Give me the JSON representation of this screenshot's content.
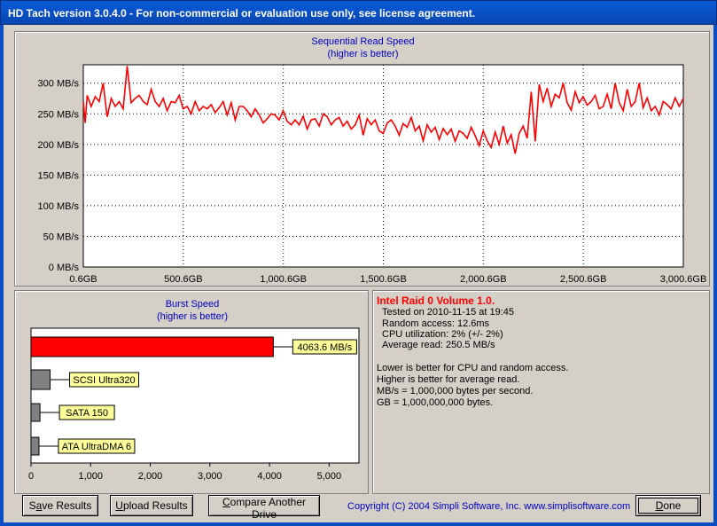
{
  "window": {
    "title": "HD Tach version 3.0.4.0  - For non-commercial or evaluation use only, see license agreement."
  },
  "chart_data": [
    {
      "type": "line",
      "title": "Sequential Read Speed",
      "subtitle": "(higher is better)",
      "ylim": [
        0,
        330
      ],
      "xlim": [
        0.6,
        3000.6
      ],
      "y_ticks": [
        "0 MB/s",
        "50 MB/s",
        "100 MB/s",
        "150 MB/s",
        "200 MB/s",
        "250 MB/s",
        "300 MB/s"
      ],
      "y_tick_values": [
        0,
        50,
        100,
        150,
        200,
        250,
        300
      ],
      "x_ticks": [
        "0.6GB",
        "500.6GB",
        "1,000.6GB",
        "1,500.6GB",
        "2,000.6GB",
        "2,500.6GB",
        "3,000.6GB"
      ],
      "x_tick_values": [
        0.6,
        500.6,
        1000.6,
        1500.6,
        2000.6,
        2500.6,
        3000.6
      ],
      "grid": true,
      "line_color": "#ff0000",
      "x": [
        0.6,
        10,
        20,
        40,
        60,
        80,
        100,
        120,
        140,
        160,
        180,
        200,
        220,
        240,
        260,
        280,
        300,
        320,
        340,
        360,
        380,
        400,
        420,
        440,
        460,
        480,
        500,
        520,
        540,
        560,
        580,
        600,
        620,
        640,
        660,
        680,
        700,
        720,
        740,
        760,
        780,
        800,
        820,
        840,
        860,
        880,
        900,
        920,
        940,
        960,
        980,
        1000,
        1020,
        1040,
        1060,
        1080,
        1100,
        1120,
        1140,
        1160,
        1180,
        1200,
        1220,
        1240,
        1260,
        1280,
        1300,
        1320,
        1340,
        1360,
        1380,
        1400,
        1420,
        1440,
        1460,
        1480,
        1500,
        1520,
        1540,
        1560,
        1580,
        1600,
        1620,
        1640,
        1660,
        1680,
        1700,
        1720,
        1740,
        1760,
        1780,
        1800,
        1820,
        1840,
        1860,
        1880,
        1900,
        1920,
        1940,
        1960,
        1980,
        2000,
        2020,
        2040,
        2060,
        2080,
        2100,
        2120,
        2140,
        2160,
        2180,
        2200,
        2220,
        2240,
        2260,
        2280,
        2300,
        2320,
        2340,
        2360,
        2380,
        2400,
        2420,
        2440,
        2460,
        2480,
        2500,
        2520,
        2540,
        2560,
        2580,
        2600,
        2620,
        2640,
        2660,
        2680,
        2700,
        2720,
        2740,
        2760,
        2780,
        2800,
        2820,
        2840,
        2860,
        2880,
        2900,
        2920,
        2940,
        2960,
        2980,
        3000.6
      ],
      "y": [
        270,
        235,
        280,
        262,
        278,
        270,
        300,
        245,
        275,
        262,
        270,
        258,
        328,
        268,
        275,
        280,
        270,
        265,
        290,
        270,
        262,
        275,
        255,
        270,
        268,
        280,
        258,
        262,
        250,
        270,
        255,
        262,
        258,
        265,
        252,
        260,
        270,
        248,
        268,
        240,
        262,
        262,
        255,
        245,
        258,
        248,
        235,
        242,
        250,
        248,
        240,
        255,
        238,
        232,
        240,
        232,
        246,
        225,
        240,
        242,
        230,
        250,
        245,
        232,
        240,
        244,
        230,
        238,
        225,
        232,
        248,
        215,
        242,
        232,
        240,
        222,
        218,
        235,
        240,
        230,
        215,
        234,
        228,
        244,
        222,
        230,
        206,
        232,
        220,
        228,
        208,
        226,
        216,
        225,
        205,
        222,
        218,
        210,
        228,
        214,
        198,
        222,
        206,
        195,
        220,
        200,
        230,
        202,
        216,
        185,
        218,
        230,
        210,
        286,
        205,
        298,
        270,
        292,
        262,
        282,
        276,
        300,
        268,
        256,
        286,
        268,
        278,
        264,
        270,
        280,
        258,
        262,
        282,
        258,
        300,
        268,
        255,
        290,
        262,
        270,
        300,
        260,
        276,
        255,
        262,
        248,
        270,
        265,
        258,
        276,
        262,
        275,
        268,
        275,
        265,
        252
      ]
    },
    {
      "type": "bar",
      "orientation": "horizontal",
      "title": "Burst Speed",
      "subtitle": "(higher is better)",
      "xlim": [
        0,
        5500
      ],
      "x_ticks": [
        "0",
        "1,000",
        "2,000",
        "3,000",
        "4,000",
        "5,000"
      ],
      "x_tick_values": [
        0,
        1000,
        2000,
        3000,
        4000,
        5000
      ],
      "categories": [
        "4063.6 MB/s",
        "SCSI Ultra320",
        "SATA 150",
        "ATA UltraDMA 6"
      ],
      "values": [
        4063.6,
        320,
        150,
        133
      ],
      "colors": [
        "#ff0000",
        "#808080",
        "#808080",
        "#808080"
      ],
      "label_bg": "#ffff99"
    }
  ],
  "info": {
    "heading": "Intel Raid 0 Volume 1.0.",
    "tested": "Tested on 2010-11-15 at 19:45",
    "random_access": "Random access: 12.6ms",
    "cpu": "CPU utilization: 2% (+/- 2%)",
    "average_read": "Average read: 250.5 MB/s",
    "note1": "Lower is better for CPU and random access.",
    "note2": "Higher is better for average read.",
    "note3": "MB/s = 1,000,000 bytes per second.",
    "note4": "GB = 1,000,000,000 bytes."
  },
  "buttons": {
    "save_pre": "S",
    "save_ul": "a",
    "save_post": "ve Results",
    "upload_pre": "",
    "upload_ul": "U",
    "upload_post": "pload Results",
    "compare_pre": "",
    "compare_ul": "C",
    "compare_post": "ompare Another Drive",
    "done_pre": "",
    "done_ul": "D",
    "done_post": "one"
  },
  "copyright": "Copyright (C) 2004 Simpli Software, Inc. www.simplisoftware.com"
}
